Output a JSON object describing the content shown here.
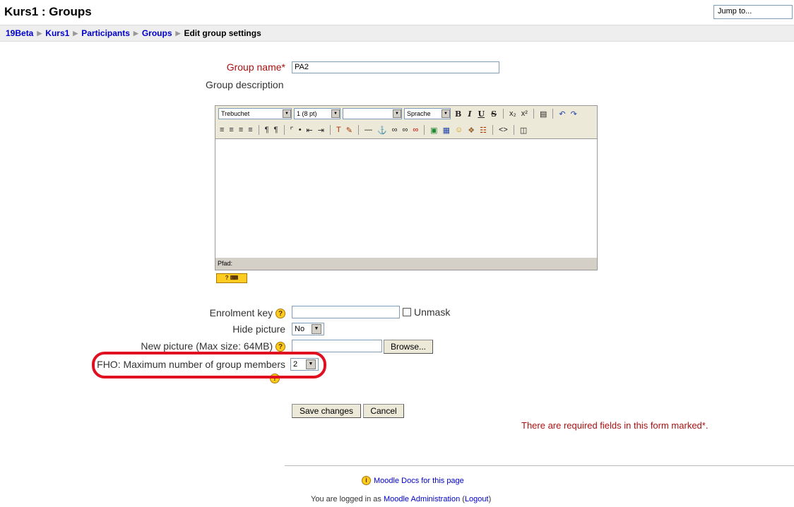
{
  "header": {
    "title": "Kurs1 : Groups",
    "jump_placeholder": "Jump to..."
  },
  "breadcrumb": [
    {
      "label": "19Beta"
    },
    {
      "label": "Kurs1"
    },
    {
      "label": "Participants"
    },
    {
      "label": "Groups"
    },
    {
      "label": "Edit group settings"
    }
  ],
  "form": {
    "group_name_label": "Group name",
    "required_mark": "*",
    "group_name_value": "PA2",
    "description_label": "Group description",
    "enrolment_key_label": "Enrolment key",
    "unmask_label": "Unmask",
    "hide_picture_label": "Hide picture",
    "hide_picture_value": "No",
    "new_picture_label": "New picture (Max size: 64MB)",
    "browse_label": "Browse...",
    "max_members_label": "FHO: Maximum number of group members",
    "max_members_value": "2",
    "save_label": "Save changes",
    "cancel_label": "Cancel",
    "required_note": "There are required fields in this form marked"
  },
  "editor": {
    "font_family": "Trebuchet",
    "font_size": "1 (8 pt)",
    "format": "",
    "language": "Sprache",
    "path_label": "Pfad:"
  },
  "footer": {
    "docs_link": "Moodle Docs for this page",
    "logged_in_prefix": "You are logged in as",
    "user_name": "Moodle Administration",
    "logout_label": "Logout"
  },
  "colors": {
    "link": "#0000cc",
    "required": "#aa1111",
    "highlight": "#e01020"
  }
}
